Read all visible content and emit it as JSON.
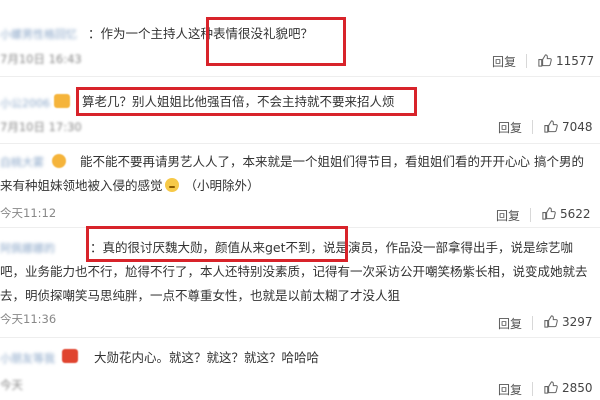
{
  "comments": [
    {
      "name": "小螺男性格回忆",
      "text": "：作为一个主持人这种表情很没礼貌吧？",
      "time": "7月10日 16:43",
      "reply": "回复",
      "likes": "11577"
    },
    {
      "name": "小公2006",
      "text": "算老几？别人姐姐比他强百倍，不会主持就不要来招人烦",
      "time": "7月10日 17:30",
      "reply": "回复",
      "likes": "7048"
    },
    {
      "name": "白桃大雾",
      "line1": "能不能不要再请男艺人人了，本来就是一个姐姐们得节目，看姐姐们看的开开心心 搞个男的",
      "line2": "来有种姐妹领地被入侵的感觉",
      "line2_tail": "（小明除外）",
      "time": "今天11:12",
      "reply": "回复",
      "likes": "5622"
    },
    {
      "name": "阿佩娜娜的",
      "line1": "：真的很讨厌魏大勋，颜值从来get不到，说是演员，作品没一部拿得出手，说是综艺咖",
      "line2": "吧，业务能力也不行，尬得不行了，本人还特别没素质，记得有一次采访公开嘲笑杨紫长相，说变成她就去",
      "line3": "去，明侦探嘲笑马思纯胖，一点不尊重女性，也就是以前太糊了才没人狙",
      "time": "今天11:36",
      "reply": "回复",
      "likes": "3297"
    },
    {
      "name": "小朋友等我",
      "text": "大勋花内心。就这？就这？就这？哈哈哈",
      "time": "今天",
      "reply": "回复",
      "likes": "2850"
    }
  ],
  "colors": {
    "highlight": "#d8232a",
    "link_name": "#8aa6c8"
  },
  "icons": {
    "like": "thumbs-up-icon",
    "reaction": "smiley-emoji-icon"
  }
}
